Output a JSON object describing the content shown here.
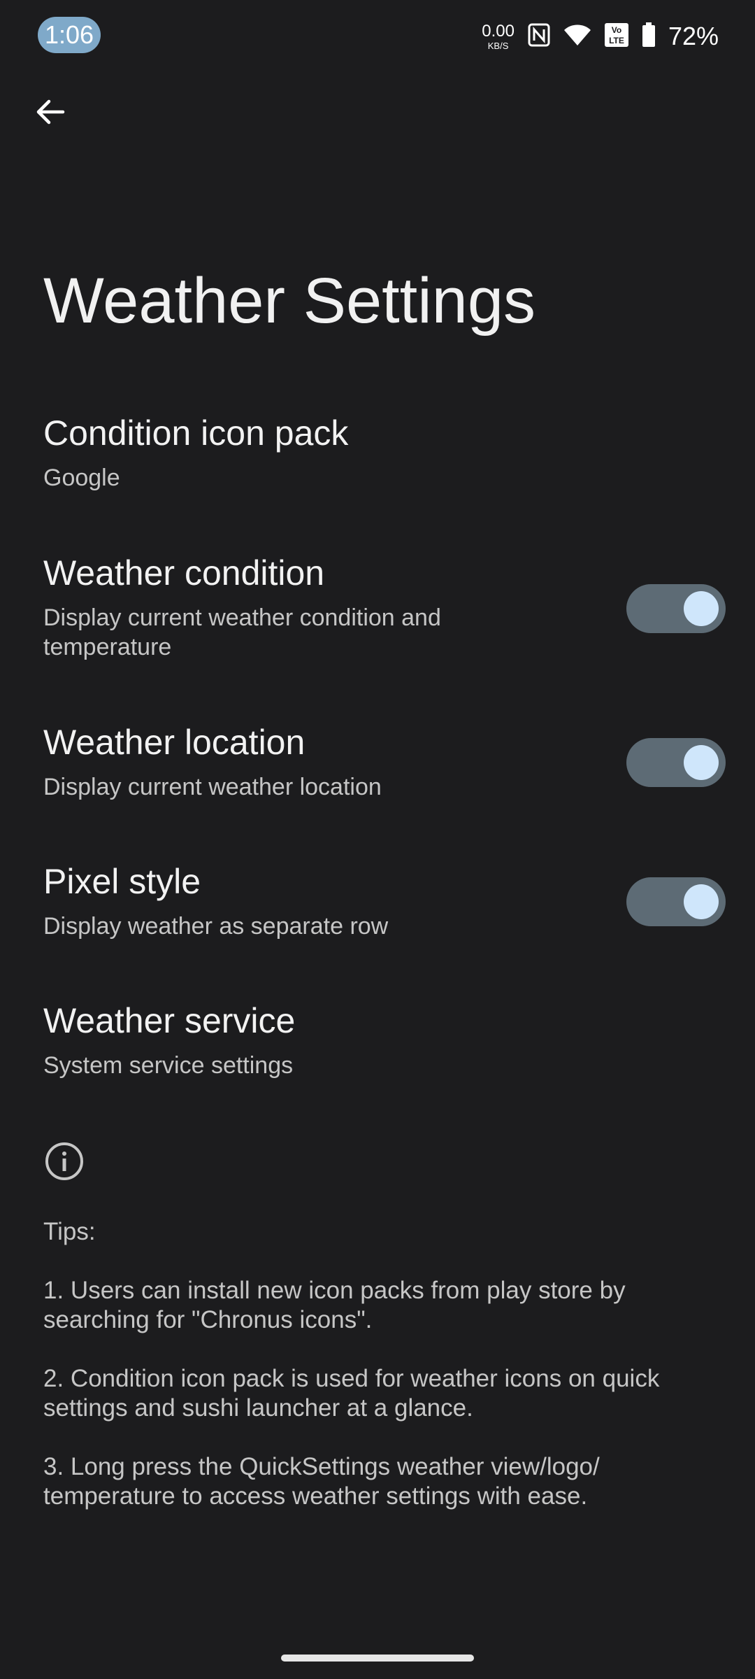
{
  "status_bar": {
    "time": "1:06",
    "net_speed_value": "0.00",
    "net_speed_unit": "KB/S",
    "icons": [
      "nfc-icon",
      "wifi-icon",
      "volte-icon",
      "battery-icon"
    ],
    "battery_percent": "72%"
  },
  "header": {
    "back_icon": "arrow-back-icon",
    "title": "Weather Settings"
  },
  "settings": [
    {
      "title": "Condition icon pack",
      "summary": "Google"
    },
    {
      "title": "Weather condition",
      "summary": "Display current weather condition and temperature",
      "toggle_on": true
    },
    {
      "title": "Weather location",
      "summary": "Display current weather location",
      "toggle_on": true
    },
    {
      "title": "Pixel style",
      "summary": "Display weather as separate row",
      "toggle_on": true
    },
    {
      "title": "Weather service",
      "summary": "System service settings"
    }
  ],
  "info": {
    "icon": "info-icon",
    "tips_heading": "Tips:",
    "tips": [
      "1. Users can install new icon packs from play store by searching for \"Chronus icons\".",
      "2. Condition icon pack is used for weather icons on quick settings and sushi launcher at a glance.",
      "3. Long press the QuickSettings weather view/logo/ temperature to access weather settings with ease."
    ]
  },
  "colors": {
    "background": "#1c1c1e",
    "toggle_track": "#5d6b75",
    "toggle_knob": "#cfe6fb",
    "time_pill": "#7fa9c9"
  }
}
